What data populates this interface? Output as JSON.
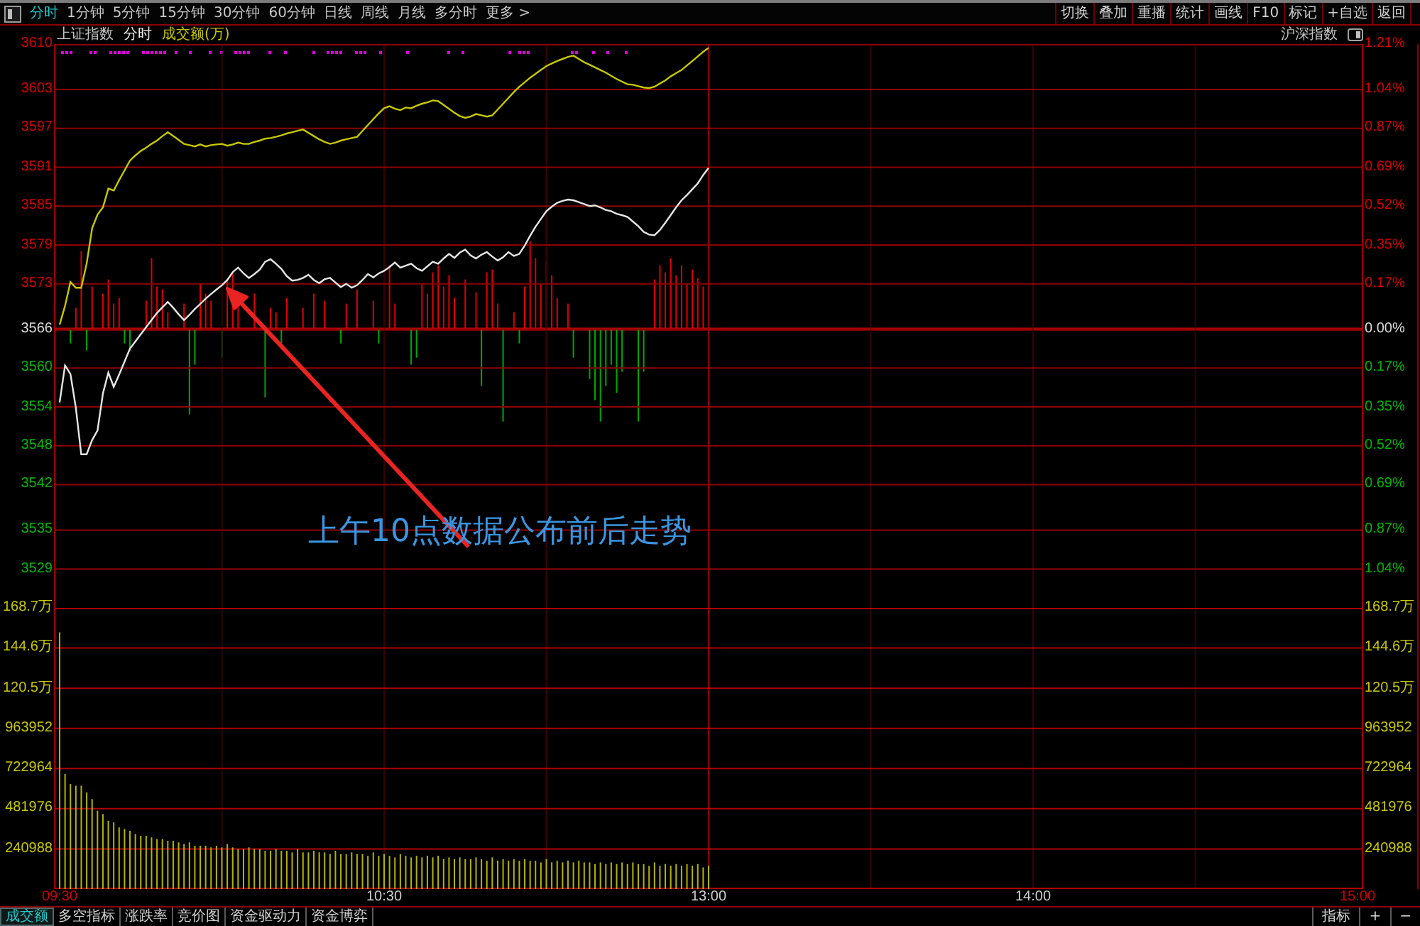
{
  "toolbar": {
    "period_tabs": [
      {
        "label": "分时",
        "selected": true
      },
      {
        "label": "1分钟",
        "selected": false
      },
      {
        "label": "5分钟",
        "selected": false
      },
      {
        "label": "15分钟",
        "selected": false
      },
      {
        "label": "30分钟",
        "selected": false
      },
      {
        "label": "60分钟",
        "selected": false
      },
      {
        "label": "日线",
        "selected": false
      },
      {
        "label": "周线",
        "selected": false
      },
      {
        "label": "月线",
        "selected": false
      },
      {
        "label": "多分时",
        "selected": false
      },
      {
        "label": "更多 >",
        "selected": false
      }
    ],
    "actions": [
      "切换",
      "叠加",
      "重播",
      "统计",
      "画线",
      "F10",
      "标记",
      "+自选",
      "返回"
    ]
  },
  "header": {
    "legend": [
      {
        "label": "上证指数",
        "kind": "index"
      },
      {
        "label": "分时",
        "kind": "period"
      },
      {
        "label": "成交额(万)",
        "kind": "metric"
      }
    ],
    "overlay": "沪深指数"
  },
  "price_panel": {
    "chart_data": {
      "type": "line",
      "grid": true,
      "ylim": [
        3523,
        3610
      ],
      "categories": [
        null,
        null,
        null,
        null,
        null,
        null,
        null,
        null,
        null,
        null,
        null,
        null,
        null,
        null,
        null,
        null,
        null,
        null,
        null,
        null,
        null,
        null,
        null,
        null,
        null,
        null,
        null,
        null,
        null,
        null,
        null,
        null,
        null,
        null,
        null,
        null,
        null,
        null,
        null,
        null,
        null,
        null,
        null,
        null,
        null,
        null,
        null,
        null,
        null,
        null,
        null,
        null,
        null,
        null,
        null,
        null,
        null,
        null,
        null,
        null,
        null,
        null,
        null,
        null,
        null,
        null,
        null,
        null,
        null,
        null,
        null,
        null,
        null,
        null,
        null,
        null,
        null,
        null,
        null,
        null,
        null,
        null,
        null,
        null,
        null,
        null,
        null,
        null,
        null,
        null,
        null,
        null,
        null,
        null,
        null,
        null,
        null,
        null,
        null,
        null,
        null,
        null,
        null,
        null,
        null,
        null,
        null,
        null,
        null,
        null,
        null,
        null,
        null,
        null,
        null,
        null,
        null,
        null,
        null,
        null,
        null,
        null,
        null,
        null,
        null,
        null,
        null,
        null,
        null,
        null,
        null,
        null,
        null,
        null,
        null,
        null,
        null,
        null,
        null,
        null,
        null,
        null,
        null,
        null,
        null,
        null,
        null,
        null,
        null,
        null,
        null,
        null,
        null,
        null,
        null,
        null,
        null,
        null,
        null,
        null,
        null,
        null,
        null,
        null,
        null,
        null,
        null,
        null,
        null,
        null,
        null,
        null,
        null,
        null,
        null,
        null,
        null,
        null,
        null,
        null,
        null,
        null,
        null,
        null,
        null,
        null,
        null,
        null,
        null,
        null,
        null,
        null,
        null,
        null,
        null,
        null,
        null,
        null,
        null,
        null,
        null,
        null,
        null,
        null,
        null,
        null,
        null,
        null,
        null,
        null,
        null,
        null,
        null,
        null,
        null,
        null,
        null,
        null,
        null,
        null,
        null,
        null,
        null,
        null,
        null,
        null,
        null,
        null,
        null,
        null,
        null,
        null,
        null,
        null,
        null,
        null,
        null,
        null,
        null,
        null,
        null
      ],
      "series": [
        {
          "color": "#e6e6e6",
          "values": [
            3554.7,
            3560.4,
            3559.1,
            3553.9,
            3546.7,
            3546.7,
            3548.9,
            3550.4,
            3556.1,
            3559.3,
            3557.1,
            3559.0,
            3561.0,
            3563.0,
            3564.1,
            3565.2,
            3566.3,
            3567.4,
            3568.5,
            3569.4,
            3570.2,
            3569.3,
            3568.3,
            3567.4,
            3568.2,
            3569.1,
            3569.9,
            3570.7,
            3571.4,
            3572.1,
            3572.8,
            3573.6,
            3574.8,
            3575.5,
            3574.6,
            3573.9,
            3574.5,
            3575.2,
            3576.4,
            3576.8,
            3576.1,
            3575.3,
            3574.2,
            3573.5,
            3573.6,
            3573.9,
            3574.4,
            3573.6,
            3573.1,
            3573.7,
            3573.9,
            3573.2,
            3572.5,
            3573.0,
            3572.4,
            3572.8,
            3573.6,
            3574.5,
            3574.0,
            3574.6,
            3575.0,
            3575.6,
            3576.3,
            3575.5,
            3575.8,
            3576.1,
            3575.4,
            3575.0,
            3575.7,
            3576.4,
            3576.1,
            3576.9,
            3577.6,
            3577.0,
            3577.8,
            3578.3,
            3577.4,
            3576.9,
            3577.5,
            3577.9,
            3577.2,
            3576.6,
            3577.1,
            3577.9,
            3577.3,
            3577.6,
            3578.9,
            3580.4,
            3581.8,
            3583.0,
            3584.2,
            3584.9,
            3585.5,
            3585.8,
            3586.0,
            3585.9,
            3585.6,
            3585.3,
            3585.0,
            3585.1,
            3584.8,
            3584.4,
            3584.2,
            3583.8,
            3583.6,
            3583.3,
            3582.6,
            3581.9,
            3581.0,
            3580.6,
            3580.5,
            3581.3,
            3582.4,
            3583.6,
            3584.8,
            3585.9,
            3586.7,
            3587.6,
            3588.5,
            3589.8,
            3590.9,
            null,
            null,
            null,
            null,
            null,
            null,
            null,
            null,
            null,
            null,
            null,
            null,
            null,
            null,
            null,
            null,
            null,
            null,
            null,
            null,
            null,
            null,
            null,
            null,
            null,
            null,
            null,
            null,
            null,
            null,
            null,
            null,
            null,
            null,
            null,
            null,
            null,
            null,
            null,
            null,
            null,
            null,
            null,
            null,
            null,
            null,
            null,
            null,
            null,
            null,
            null,
            null,
            null,
            null,
            null,
            null,
            null,
            null,
            null,
            null,
            null,
            null,
            null,
            null,
            null,
            null,
            null,
            null,
            null,
            null,
            null,
            null,
            null,
            null,
            null,
            null,
            null,
            null,
            null,
            null,
            null,
            null,
            null,
            null,
            null,
            null,
            null,
            null,
            null,
            null,
            null,
            null,
            null,
            null,
            null,
            null,
            null,
            null,
            null,
            null,
            null,
            null,
            null,
            null,
            null,
            null,
            null,
            null,
            null,
            null,
            null,
            null,
            null,
            null,
            null,
            null,
            null,
            null,
            null,
            null
          ]
        },
        {
          "color": "#c8c800",
          "values": [
            3566.7,
            3569.6,
            3573.3,
            3572.4,
            3572.4,
            3576.1,
            3581.6,
            3583.7,
            3584.8,
            3587.7,
            3587.4,
            3589.0,
            3590.5,
            3592.0,
            3592.8,
            3593.5,
            3594.0,
            3594.6,
            3595.1,
            3595.8,
            3596.4,
            3595.8,
            3595.2,
            3594.6,
            3594.4,
            3594.2,
            3594.5,
            3594.2,
            3594.4,
            3594.5,
            3594.6,
            3594.3,
            3594.5,
            3594.8,
            3594.6,
            3594.6,
            3594.9,
            3595.1,
            3595.4,
            3595.5,
            3595.7,
            3595.9,
            3596.2,
            3596.4,
            3596.6,
            3596.8,
            3596.3,
            3595.8,
            3595.3,
            3594.9,
            3594.6,
            3594.8,
            3595.1,
            3595.3,
            3595.5,
            3595.7,
            3596.6,
            3597.5,
            3598.4,
            3599.3,
            3600.1,
            3600.4,
            3600.0,
            3599.8,
            3600.2,
            3600.1,
            3600.5,
            3600.8,
            3601.0,
            3601.3,
            3601.2,
            3600.6,
            3600.0,
            3599.4,
            3598.9,
            3598.6,
            3598.8,
            3599.2,
            3599.0,
            3598.8,
            3599.0,
            3599.9,
            3600.8,
            3601.7,
            3602.6,
            3603.4,
            3604.1,
            3604.8,
            3605.4,
            3606.0,
            3606.6,
            3607.0,
            3607.4,
            3607.7,
            3608.0,
            3608.2,
            3607.7,
            3607.2,
            3606.8,
            3606.4,
            3606.0,
            3605.6,
            3605.1,
            3604.6,
            3604.2,
            3603.8,
            3603.7,
            3603.5,
            3603.3,
            3603.2,
            3603.4,
            3603.9,
            3604.4,
            3605.0,
            3605.5,
            3606.0,
            3606.7,
            3607.4,
            3608.1,
            3608.8,
            3609.4,
            null,
            null,
            null,
            null,
            null,
            null,
            null,
            null,
            null,
            null,
            null,
            null,
            null,
            null,
            null,
            null,
            null,
            null,
            null,
            null,
            null,
            null,
            null,
            null,
            null,
            null,
            null,
            null,
            null,
            null,
            null,
            null,
            null,
            null,
            null,
            null,
            null,
            null,
            null,
            null,
            null,
            null,
            null,
            null,
            null,
            null,
            null,
            null,
            null,
            null,
            null,
            null,
            null,
            null,
            null,
            null,
            null,
            null,
            null,
            null,
            null,
            null,
            null,
            null,
            null,
            null,
            null,
            null,
            null,
            null,
            null,
            null,
            null,
            null,
            null,
            null,
            null,
            null,
            null,
            null,
            null,
            null,
            null,
            null,
            null,
            null,
            null,
            null,
            null,
            null,
            null,
            null,
            null,
            null,
            null,
            null,
            null,
            null,
            null,
            null,
            null,
            null,
            null,
            null,
            null,
            null,
            null,
            null,
            null,
            null,
            null,
            null,
            null,
            null,
            null,
            null,
            null,
            null,
            null,
            null
          ]
        }
      ],
      "yticks": [
        3610,
        3603,
        3597,
        3591,
        3585,
        3579,
        3573,
        3566,
        3560,
        3554,
        3548,
        3542,
        3535,
        3529
      ]
    },
    "percent_labels": [
      {
        "label": "1.21%",
        "kind": "up"
      },
      {
        "label": "1.04%",
        "kind": "up"
      },
      {
        "label": "0.87%",
        "kind": "up"
      },
      {
        "label": "0.69%",
        "kind": "up"
      },
      {
        "label": "0.52%",
        "kind": "up"
      },
      {
        "label": "0.35%",
        "kind": "up"
      },
      {
        "label": "0.17%",
        "kind": "up"
      },
      {
        "label": "0.00%",
        "kind": "flat"
      },
      {
        "label": "0.17%",
        "kind": "down"
      },
      {
        "label": "0.35%",
        "kind": "down"
      },
      {
        "label": "0.52%",
        "kind": "down"
      },
      {
        "label": "0.69%",
        "kind": "down"
      },
      {
        "label": "0.87%",
        "kind": "down"
      },
      {
        "label": "1.04%",
        "kind": "down"
      }
    ],
    "annotation": "上午10点数据公布前后走势"
  },
  "volume_panel": {
    "chart_data": {
      "type": "bar",
      "grid": true,
      "ylim": [
        0,
        1686916
      ],
      "categories": [
        "09:30",
        null,
        null,
        null,
        null,
        null,
        null,
        null,
        null,
        null,
        null,
        null,
        null,
        null,
        null,
        null,
        null,
        null,
        null,
        null,
        null,
        null,
        null,
        null,
        null,
        null,
        null,
        null,
        null,
        null,
        null,
        null,
        null,
        null,
        null,
        null,
        null,
        null,
        null,
        null,
        null,
        null,
        null,
        null,
        null,
        null,
        null,
        null,
        null,
        null,
        null,
        null,
        null,
        null,
        null,
        null,
        null,
        null,
        null,
        null,
        "10:30",
        null,
        null,
        null,
        null,
        null,
        null,
        null,
        null,
        null,
        null,
        null,
        null,
        null,
        null,
        null,
        null,
        null,
        null,
        null,
        null,
        null,
        null,
        null,
        null,
        null,
        null,
        null,
        null,
        null,
        null,
        null,
        null,
        null,
        null,
        null,
        null,
        null,
        null,
        null,
        null,
        null,
        null,
        null,
        null,
        null,
        null,
        null,
        null,
        null,
        null,
        null,
        null,
        null,
        null,
        null,
        null,
        null,
        null,
        null,
        "13:00",
        null,
        null,
        null,
        null,
        null,
        null,
        null,
        null,
        null,
        null,
        null,
        null,
        null,
        null,
        null,
        null,
        null,
        null,
        null,
        null,
        null,
        null,
        null,
        null,
        null,
        null,
        null,
        null,
        null,
        null,
        null,
        null,
        null,
        null,
        null,
        null,
        null,
        null,
        null,
        null,
        null,
        null,
        null,
        null,
        null,
        null,
        null,
        null,
        null,
        null,
        null,
        null,
        null,
        null,
        null,
        null,
        null,
        null,
        null,
        "14:00",
        null,
        null,
        null,
        null,
        null,
        null,
        null,
        null,
        null,
        null,
        null,
        null,
        null,
        null,
        null,
        null,
        null,
        null,
        null,
        null,
        null,
        null,
        null,
        null,
        null,
        null,
        null,
        null,
        null,
        null,
        null,
        null,
        null,
        null,
        null,
        null,
        null,
        null,
        null,
        null,
        null,
        null,
        null,
        null,
        null,
        null,
        null,
        null,
        null,
        null,
        null,
        null,
        null,
        null,
        null,
        null,
        null,
        null,
        null,
        "15:00"
      ],
      "values": [
        1540000,
        690000,
        630000,
        620000,
        620000,
        580000,
        540000,
        470000,
        450000,
        410000,
        400000,
        370000,
        360000,
        350000,
        330000,
        320000,
        320000,
        310000,
        300000,
        300000,
        290000,
        290000,
        280000,
        270000,
        280000,
        260000,
        260000,
        260000,
        250000,
        260000,
        250000,
        270000,
        250000,
        240000,
        240000,
        250000,
        240000,
        240000,
        230000,
        230000,
        240000,
        230000,
        230000,
        220000,
        240000,
        220000,
        220000,
        230000,
        220000,
        220000,
        210000,
        230000,
        210000,
        210000,
        220000,
        210000,
        210000,
        200000,
        220000,
        200000,
        210000,
        200000,
        190000,
        210000,
        200000,
        190000,
        200000,
        190000,
        200000,
        190000,
        200000,
        180000,
        190000,
        180000,
        190000,
        180000,
        180000,
        190000,
        180000,
        170000,
        190000,
        170000,
        180000,
        170000,
        180000,
        170000,
        180000,
        170000,
        170000,
        160000,
        180000,
        160000,
        170000,
        160000,
        170000,
        160000,
        170000,
        160000,
        160000,
        150000,
        160000,
        150000,
        160000,
        150000,
        160000,
        150000,
        160000,
        150000,
        150000,
        140000,
        160000,
        140000,
        150000,
        140000,
        150000,
        140000,
        150000,
        140000,
        150000,
        130000,
        140000,
        null,
        null,
        null,
        null,
        null,
        null,
        null,
        null,
        null,
        null,
        null,
        null,
        null,
        null,
        null,
        null,
        null,
        null,
        null,
        null,
        null,
        null,
        null,
        null,
        null,
        null,
        null,
        null,
        null,
        null,
        null,
        null,
        null,
        null,
        null,
        null,
        null,
        null,
        null,
        null,
        null,
        null,
        null,
        null,
        null,
        null,
        null,
        null,
        null,
        null,
        null,
        null,
        null,
        null,
        null,
        null,
        null,
        null,
        null,
        null,
        null,
        null,
        null,
        null,
        null,
        null,
        null,
        null,
        null,
        null,
        null,
        null,
        null,
        null,
        null,
        null,
        null,
        null,
        null,
        null,
        null,
        null,
        null,
        null,
        null,
        null,
        null,
        null,
        null,
        null,
        null,
        null,
        null,
        null,
        null,
        null,
        null,
        null,
        null,
        null,
        null,
        null,
        null,
        null,
        null,
        null,
        null,
        null,
        null,
        null,
        null,
        null,
        null,
        null,
        null,
        null,
        null,
        null,
        null,
        null
      ],
      "yticks": [
        {
          "value": 963952,
          "label": "963952"
        },
        {
          "value": 722964,
          "label": "722964"
        },
        {
          "value": 481976,
          "label": "481976"
        },
        {
          "value": 240988,
          "label": "240988"
        }
      ]
    },
    "scaled_labels": [
      "168.7万",
      "144.6万",
      "120.5万"
    ],
    "right_labels": [
      "168.7万",
      "144.6万",
      "120.5万",
      "963952",
      "722964",
      "481976",
      "240988"
    ]
  },
  "bottom_tabs": [
    {
      "label": "成交额",
      "selected": true
    },
    {
      "label": "多空指标",
      "selected": false
    },
    {
      "label": "涨跌率",
      "selected": false
    },
    {
      "label": "竞价图",
      "selected": false
    },
    {
      "label": "资金驱动力",
      "selected": false
    },
    {
      "label": "资金博弈",
      "selected": false
    }
  ],
  "bottom_buttons": [
    "指标",
    "+",
    "−"
  ]
}
